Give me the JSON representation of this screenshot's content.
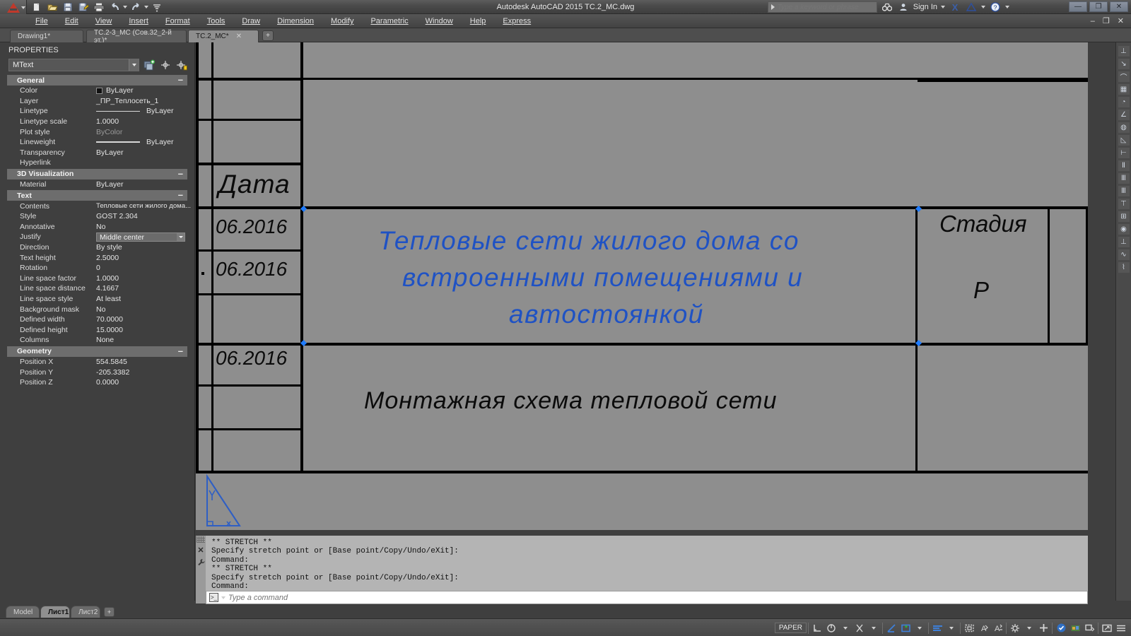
{
  "window": {
    "title": "Autodesk AutoCAD 2015   TC.2_MC.dwg",
    "min_label": "—",
    "restore_label": "❐",
    "close_label": "✕",
    "inner_min": "–",
    "inner_restore": "❐",
    "inner_close": "✕"
  },
  "quick_access": {
    "items": [
      {
        "name": "new-icon",
        "glyph": "🗋"
      },
      {
        "name": "open-icon",
        "glyph": "🗀"
      },
      {
        "name": "save-icon",
        "glyph": "🖫"
      },
      {
        "name": "saveas-icon",
        "glyph": "🖬"
      },
      {
        "name": "plot-icon",
        "glyph": "🖨"
      },
      {
        "name": "undo-icon",
        "glyph": "↩"
      },
      {
        "name": "redo-icon",
        "glyph": "↪"
      }
    ]
  },
  "infocenter": {
    "search_placeholder": "Type a keyword or phrase",
    "search_value": "",
    "sign_in": "Sign In",
    "exchange": "X",
    "help": "?"
  },
  "menu": {
    "items": [
      "File",
      "Edit",
      "View",
      "Insert",
      "Format",
      "Tools",
      "Draw",
      "Dimension",
      "Modify",
      "Parametric",
      "Window",
      "Help",
      "Express"
    ]
  },
  "file_tabs": [
    {
      "label": "Drawing1*",
      "active": false,
      "closable": false
    },
    {
      "label": "TC.2-3_MC (Сов.32_2-й эт.)*",
      "active": false,
      "closable": false
    },
    {
      "label": "TC.2_MC*",
      "active": true,
      "closable": true
    }
  ],
  "file_tab_add": "+",
  "properties": {
    "title": "PROPERTIES",
    "object_type": "MText",
    "toolbar_icons": [
      "quick-select-icon",
      "pick-add-icon",
      "select-objects-icon"
    ],
    "sections": [
      {
        "name": "General",
        "collapse": "–",
        "rows": [
          {
            "key": "Color",
            "value": "ByLayer",
            "kind": "color"
          },
          {
            "key": "Layer",
            "value": "_ПР_Теплосеть_1",
            "kind": "text"
          },
          {
            "key": "Linetype",
            "value": "ByLayer",
            "kind": "linetype"
          },
          {
            "key": "Linetype scale",
            "value": "1.0000",
            "kind": "text"
          },
          {
            "key": "Plot style",
            "value": "ByColor",
            "kind": "dim"
          },
          {
            "key": "Lineweight",
            "value": "ByLayer",
            "kind": "lineweight"
          },
          {
            "key": "Transparency",
            "value": "ByLayer",
            "kind": "text"
          },
          {
            "key": "Hyperlink",
            "value": "",
            "kind": "text"
          }
        ]
      },
      {
        "name": "3D Visualization",
        "collapse": "–",
        "rows": [
          {
            "key": "Material",
            "value": "ByLayer",
            "kind": "text"
          }
        ]
      },
      {
        "name": "Text",
        "collapse": "–",
        "rows": [
          {
            "key": "Contents",
            "value": "Тепловые сети жилого дома...",
            "kind": "text"
          },
          {
            "key": "Style",
            "value": "GOST 2.304",
            "kind": "text"
          },
          {
            "key": "Annotative",
            "value": "No",
            "kind": "text"
          },
          {
            "key": "Justify",
            "value": "Middle center",
            "kind": "select"
          },
          {
            "key": "Direction",
            "value": "By style",
            "kind": "text"
          },
          {
            "key": "Text height",
            "value": "2.5000",
            "kind": "text"
          },
          {
            "key": "Rotation",
            "value": "0",
            "kind": "text"
          },
          {
            "key": "Line space factor",
            "value": "1.0000",
            "kind": "text"
          },
          {
            "key": "Line space distance",
            "value": "4.1667",
            "kind": "text"
          },
          {
            "key": "Line space style",
            "value": "At least",
            "kind": "text"
          },
          {
            "key": "Background mask",
            "value": "No",
            "kind": "text"
          },
          {
            "key": "Defined width",
            "value": "70.0000",
            "kind": "text"
          },
          {
            "key": "Defined height",
            "value": "15.0000",
            "kind": "text"
          },
          {
            "key": "Columns",
            "value": "None",
            "kind": "text"
          }
        ]
      },
      {
        "name": "Geometry",
        "collapse": "–",
        "rows": [
          {
            "key": "Position X",
            "value": "554.5845",
            "kind": "text"
          },
          {
            "key": "Position Y",
            "value": "-205.3382",
            "kind": "text"
          },
          {
            "key": "Position Z",
            "value": "0.0000",
            "kind": "text"
          }
        ]
      }
    ]
  },
  "drawing": {
    "header_cell": "Дата",
    "dates": [
      "06.2016",
      "06.2016",
      "06.2016"
    ],
    "title_main": [
      "Тепловые сети жилого дома  со",
      "встроенными помещениями и",
      "автостоянкой"
    ],
    "subtitle": "Монтажная схема тепловой сети",
    "stage_label": "Стадия",
    "stage_value": "Р",
    "selection_color": "#1f7cff",
    "text_color_selected": "#1f52c4",
    "text_color": "#0b0b0b",
    "background": "#8e8e8e"
  },
  "command_line": {
    "history": [
      "** STRETCH **",
      "Specify stretch point or [Base point/Copy/Undo/eXit]:",
      "Command:",
      "** STRETCH **",
      "Specify stretch point or [Base point/Copy/Undo/eXit]:",
      "Command:"
    ],
    "input_placeholder": "Type a command",
    "input_value": "",
    "close_glyph": "✕",
    "wrench_glyph": "🔧"
  },
  "layout_tabs": [
    {
      "label": "Model",
      "active": false
    },
    {
      "label": "Лист1",
      "active": true
    },
    {
      "label": "Лист2",
      "active": false
    }
  ],
  "layout_tab_add": "+",
  "status_bar": {
    "space_mode": "PAPER",
    "icons": [
      {
        "name": "snap-grid-icon",
        "glyph": "⌐",
        "blue": false
      },
      {
        "name": "ortho-polar-icon",
        "glyph": "◔",
        "blue": false
      },
      {
        "name": "osnap-icon",
        "glyph": "⦦",
        "blue": false
      },
      {
        "name": "otrack-icon",
        "glyph": "∠",
        "blue": true
      },
      {
        "name": "ucs-icon-icon",
        "glyph": "◫",
        "blue": true
      },
      {
        "name": "annotation-scale-icon",
        "glyph": "≡",
        "blue": true
      },
      {
        "name": "viewport-icon",
        "glyph": "▣",
        "blue": false
      },
      {
        "name": "annotation-visibility-icon",
        "glyph": "Ⓐ",
        "blue": false
      },
      {
        "name": "autoscale-icon",
        "glyph": "Ⓐ",
        "blue": false
      },
      {
        "name": "workspace-gear-icon",
        "glyph": "⚙",
        "blue": false
      },
      {
        "name": "hardware-accel-icon",
        "glyph": "✛",
        "blue": false
      },
      {
        "name": "isolate-objects-icon",
        "glyph": "◉",
        "blue": true
      },
      {
        "name": "graphics-perf-icon",
        "glyph": "▦",
        "blue": false
      },
      {
        "name": "clean-screen-icon",
        "glyph": "⬚",
        "blue": false
      },
      {
        "name": "fullscreen-icon",
        "glyph": "⛶",
        "blue": false
      },
      {
        "name": "customization-icon",
        "glyph": "☰",
        "blue": false
      }
    ]
  },
  "right_dock": {
    "icons": [
      "linear-dim-icon",
      "leader-icon",
      "arc-dim-icon",
      "table-icon",
      "radius-dim-icon",
      "angular-dim-icon",
      "diameter-dim-icon",
      "aligned-dim-icon",
      "baseline-dim-icon",
      "continue-dim-icon",
      "ordinate-dim-icon",
      "quick-dim-icon",
      "tolerance-icon",
      "center-mark-icon",
      "dim-style-icon",
      "dim-update-icon",
      "inspect-dim-icon",
      "jogged-dim-icon"
    ]
  }
}
